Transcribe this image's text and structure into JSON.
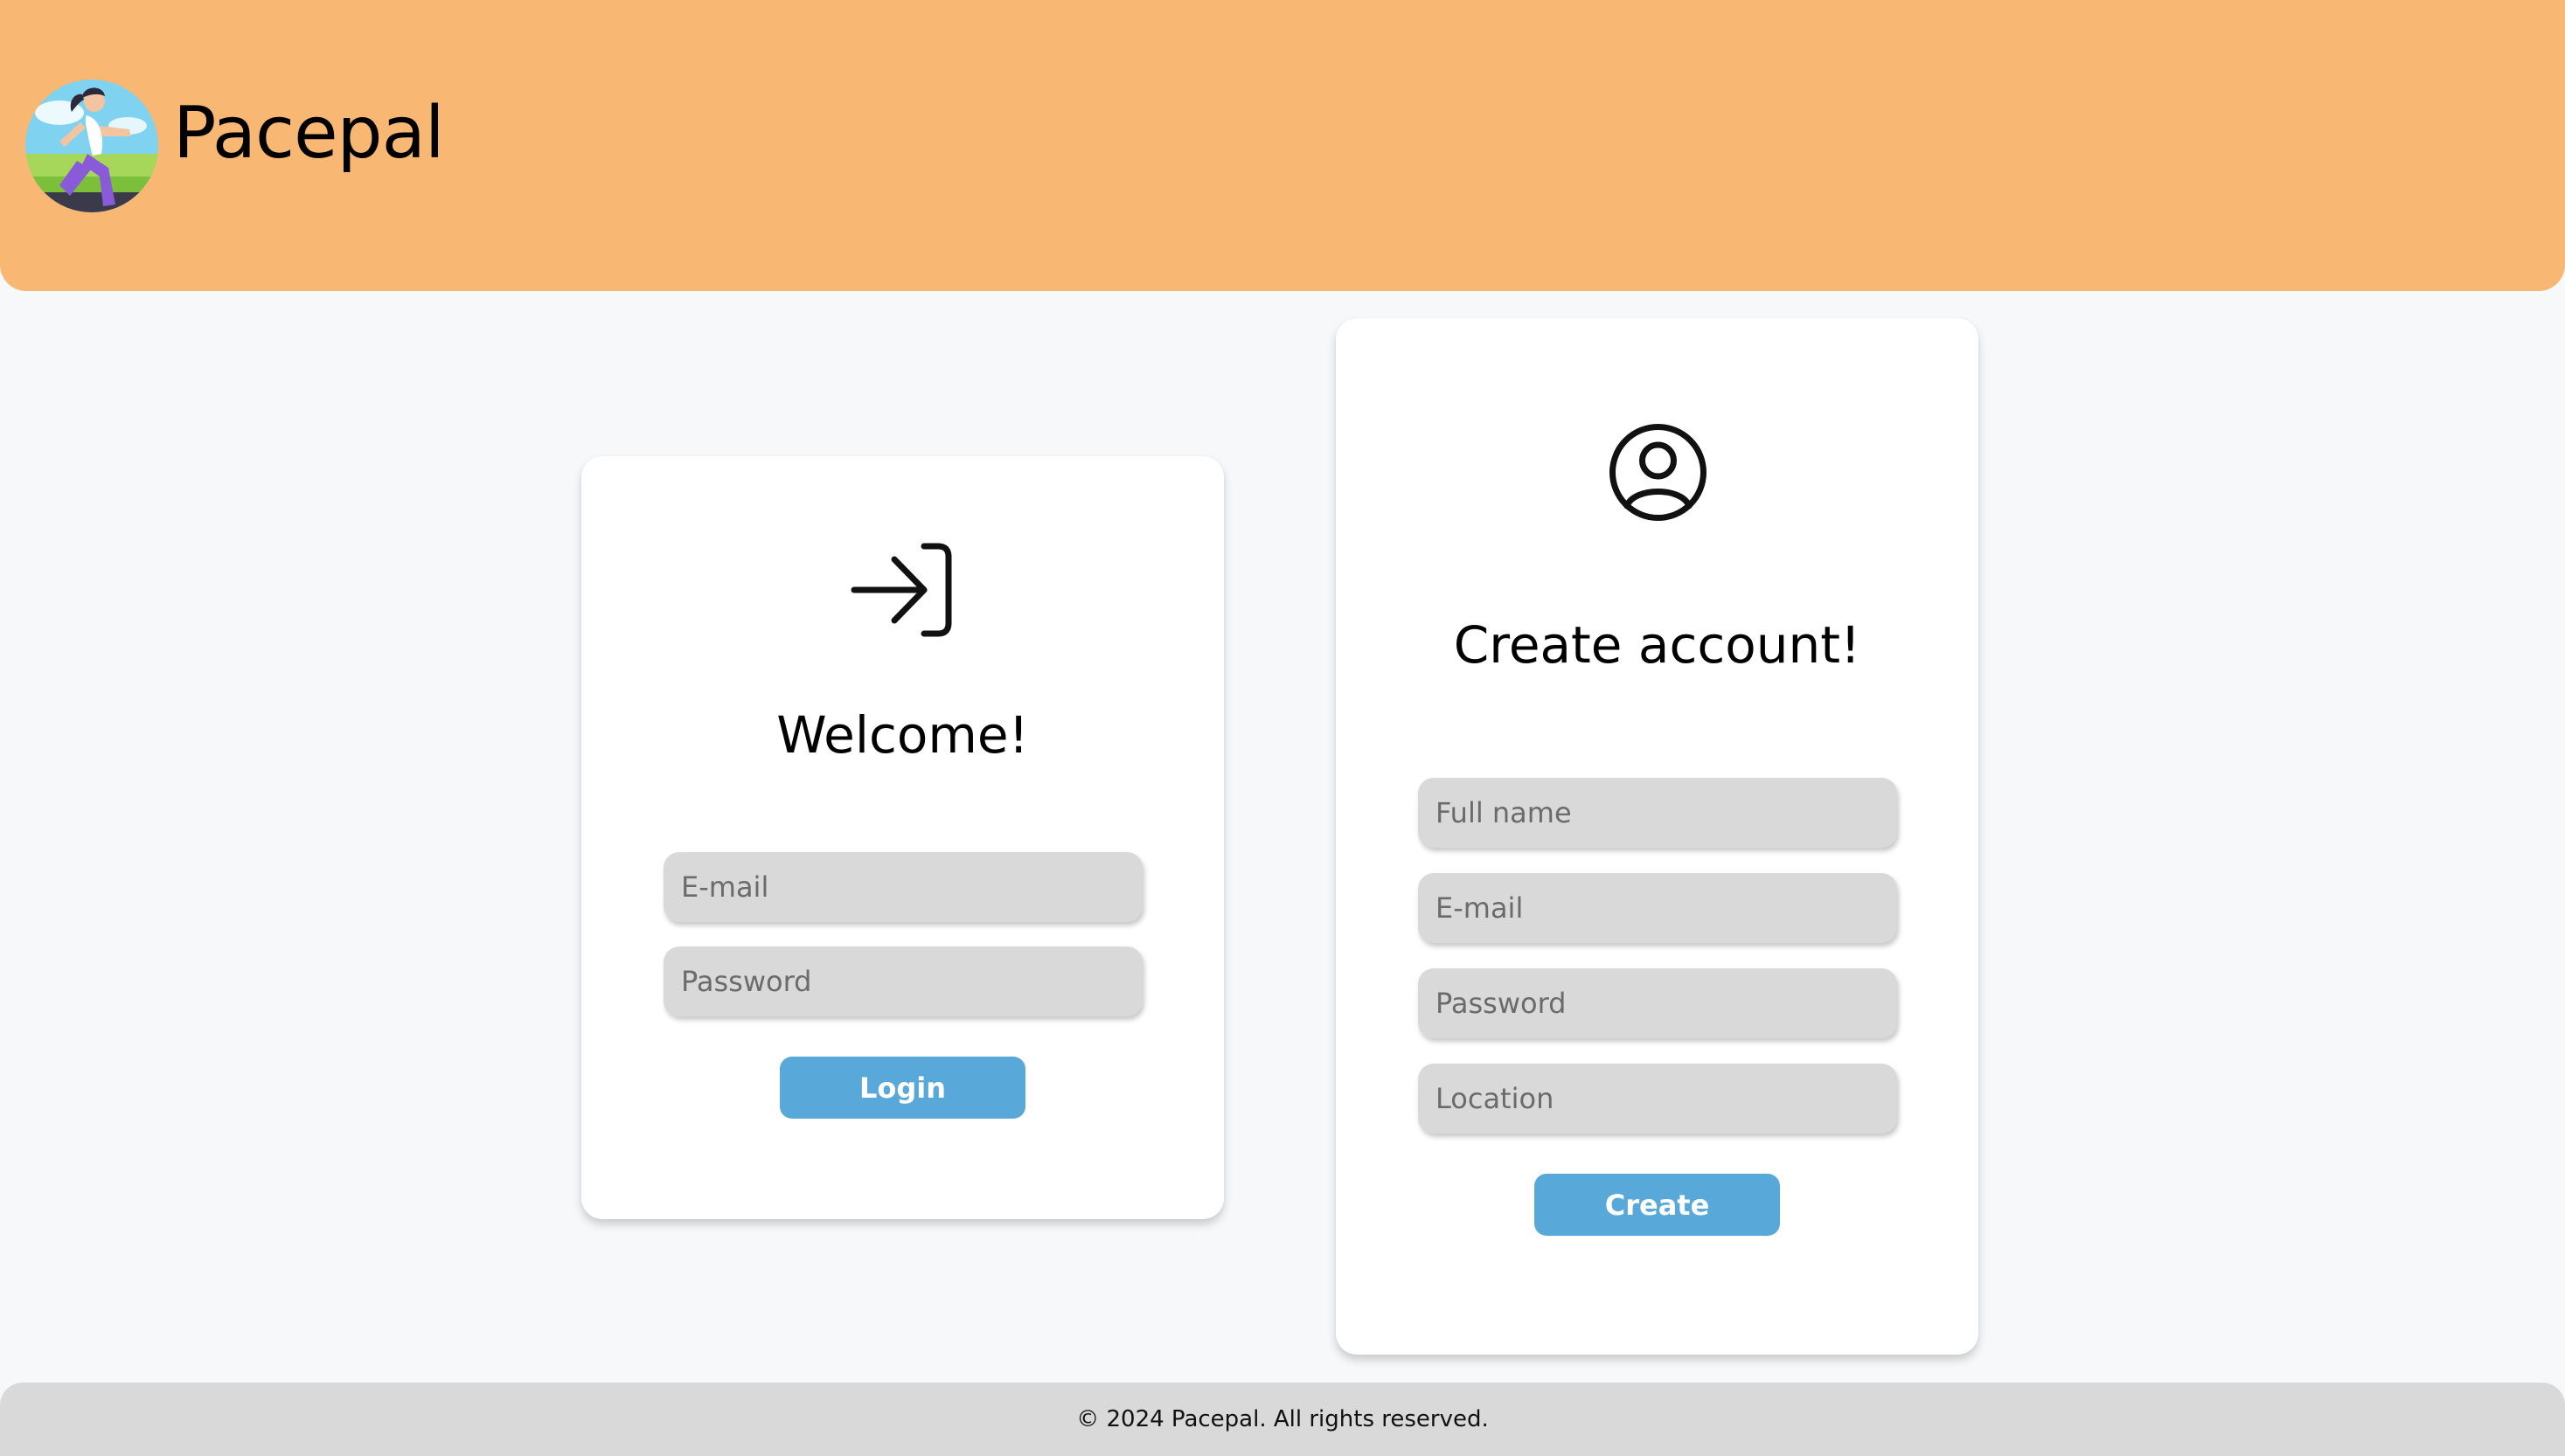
{
  "header": {
    "brand_name": "Pacepal",
    "logo_icon": "runner-logo-icon",
    "background_color": "#f8b873"
  },
  "login": {
    "icon": "login-arrow-icon",
    "title": "Welcome!",
    "email_placeholder": "E-mail",
    "password_placeholder": "Password",
    "button_label": "Login"
  },
  "create": {
    "icon": "user-circle-icon",
    "title": "Create account!",
    "fullname_placeholder": "Full name",
    "email_placeholder": "E-mail",
    "password_placeholder": "Password",
    "location_placeholder": "Location",
    "button_label": "Create"
  },
  "footer": {
    "text": "© 2024 Pacepal. All rights reserved."
  },
  "colors": {
    "accent_button": "#58a8d9",
    "field_background": "#d9d9d9",
    "page_background": "#f6f8fa"
  }
}
